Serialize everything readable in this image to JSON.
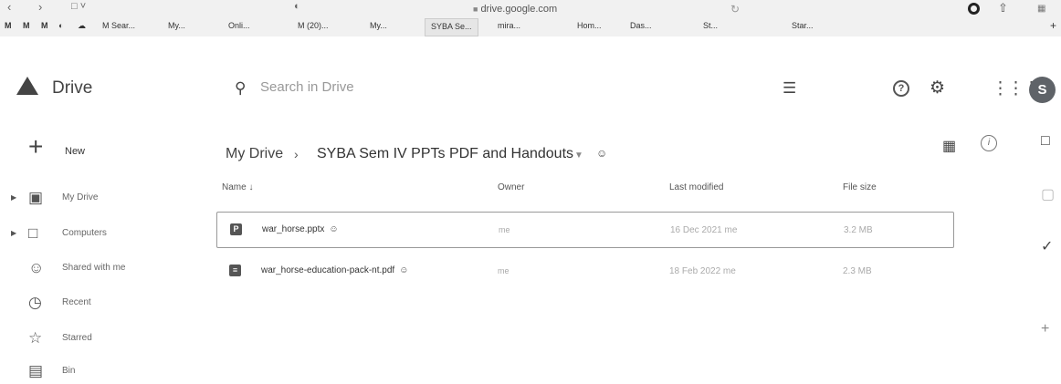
{
  "browser": {
    "url": "drive.google.com",
    "bookmarks": [
      "M",
      "M",
      "M",
      "M Sear...",
      "My...",
      "Onli...",
      "M (20)...",
      "My...",
      "SYBA Se...",
      "mira...",
      "Hom...",
      "Das...",
      "St...",
      "Star..."
    ]
  },
  "header": {
    "brand": "Drive",
    "search_placeholder": "Search in Drive",
    "avatar_letter": "S"
  },
  "sidebar": {
    "new_label": "New",
    "items": [
      {
        "label": "My Drive",
        "icon": "my-drive-icon"
      },
      {
        "label": "Computers",
        "icon": "computers-icon"
      },
      {
        "label": "Shared with me",
        "icon": "shared-icon"
      },
      {
        "label": "Recent",
        "icon": "clock-icon"
      },
      {
        "label": "Starred",
        "icon": "star-icon"
      },
      {
        "label": "Bin",
        "icon": "bin-icon"
      }
    ]
  },
  "breadcrumb": {
    "root": "My Drive",
    "current": "SYBA Sem IV PPTs PDF and Handouts"
  },
  "table": {
    "headers": {
      "name": "Name",
      "owner": "Owner",
      "modified": "Last modified",
      "size": "File size"
    },
    "rows": [
      {
        "name": "war_horse.pptx",
        "icon_letter": "P",
        "owner": "me",
        "modified": "16 Dec 2021 me",
        "size": "3.2 MB"
      },
      {
        "name": "war_horse-education-pack-nt.pdf",
        "icon_letter": "≡",
        "owner": "me",
        "modified": "18 Feb 2022 me",
        "size": "2.3 MB"
      }
    ]
  }
}
